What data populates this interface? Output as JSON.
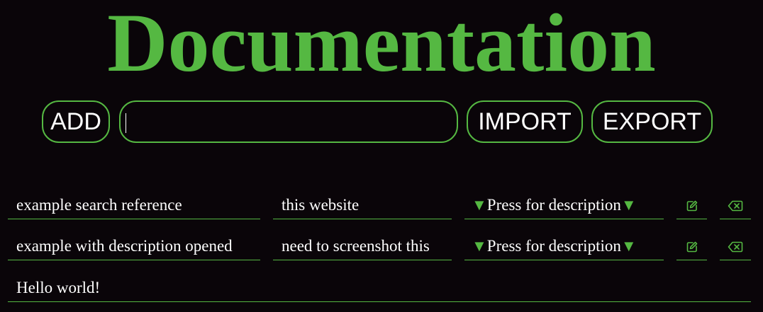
{
  "header": {
    "title": "Documentation"
  },
  "toolbar": {
    "add_label": "ADD",
    "search_value": "",
    "search_placeholder": "",
    "import_label": "IMPORT",
    "export_label": "EXPORT"
  },
  "colors": {
    "accent": "#55b842",
    "background": "#0a0509",
    "text": "#ffffff"
  },
  "rows": [
    {
      "name": "example search reference",
      "link": "this website",
      "description_toggle": "Press for description",
      "arrow_icon": "triangle-down-icon",
      "edit_icon": "edit-icon",
      "delete_icon": "backspace-icon"
    },
    {
      "name": "example with description opened",
      "link": "need to screenshot this",
      "description_toggle": "Press for description",
      "arrow_icon": "triangle-down-icon",
      "edit_icon": "edit-icon",
      "delete_icon": "backspace-icon"
    }
  ],
  "opened_description": "Hello world!"
}
